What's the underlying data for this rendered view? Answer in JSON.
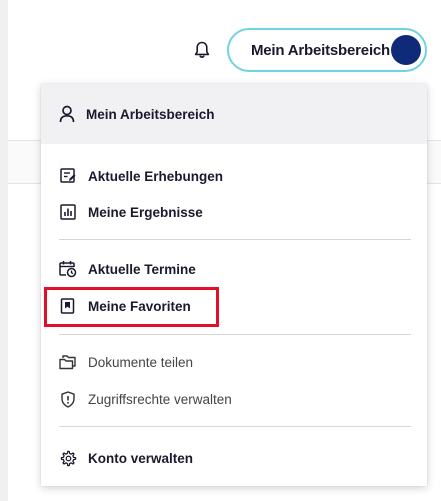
{
  "header": {
    "workspace_button_label": "Mein Arbeitsbereich",
    "accent_color": "#6fd3e0",
    "avatar_color": "#0e2a78"
  },
  "menu": {
    "header_label": "Mein Arbeitsbereich",
    "items": [
      {
        "label": "Aktuelle Erhebungen",
        "icon": "survey-edit-icon"
      },
      {
        "label": "Meine Ergebnisse",
        "icon": "results-chart-icon"
      },
      {
        "label": "Aktuelle Termine",
        "icon": "calendar-clock-icon"
      },
      {
        "label": "Meine Favoriten",
        "icon": "bookmark-icon"
      },
      {
        "label": "Dokumente teilen",
        "icon": "folders-icon"
      },
      {
        "label": "Zugriffsrechte verwalten",
        "icon": "shield-alert-icon"
      },
      {
        "label": "Konto verwalten",
        "icon": "gear-icon"
      }
    ],
    "highlight_color": "#e0102a"
  }
}
